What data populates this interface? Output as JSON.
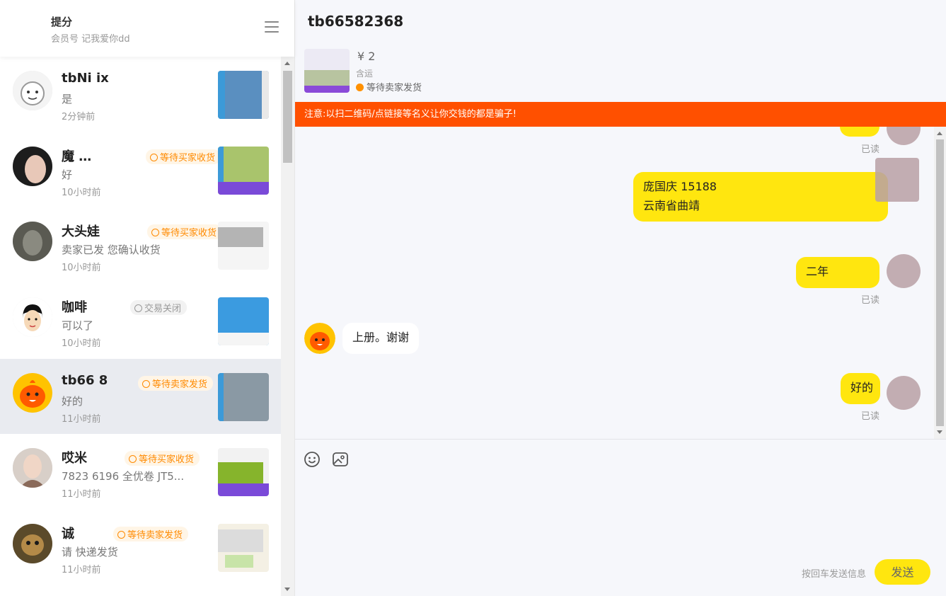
{
  "sidebar": {
    "account_name": "提分",
    "account_sub": "会员号 记我爱你dd",
    "conversations": [
      {
        "name": "tbNi       ix",
        "badge": "",
        "message": "是",
        "time": "2分钟前"
      },
      {
        "name": "魔        …",
        "badge": "等待买家收货",
        "message": "好",
        "time": "10小时前"
      },
      {
        "name": "大头娃",
        "badge": "等待买家收货",
        "message": "卖家已发      您确认收货",
        "time": "10小时前"
      },
      {
        "name": "咖啡",
        "badge": "交易关闭",
        "message": "可以了",
        "time": "10小时前"
      },
      {
        "name": "tb66      8",
        "badge": "等待卖家发货",
        "message": "好的",
        "time": "11小时前"
      },
      {
        "name": "哎米",
        "badge": "等待买家收货",
        "message": "7823     6196 全优卷 JT5...",
        "time": "11小时前"
      },
      {
        "name": "诚",
        "badge": "等待卖家发货",
        "message": "请        快递发货",
        "time": "11小时前"
      }
    ]
  },
  "chat": {
    "title": "tb66582368",
    "order": {
      "price": "¥ 2",
      "shipping": "含运",
      "status": "等待卖家发货"
    },
    "warning": "注意:以扫二维码/点链接等名义让你交钱的都是骗子!",
    "messages": [
      {
        "from": "me",
        "text": "",
        "read": "已读"
      },
      {
        "from": "me",
        "line1": "庞国庆 15188",
        "line2": "云南省曲靖",
        "read": ""
      },
      {
        "from": "me",
        "text": "二年",
        "read": "已读"
      },
      {
        "from": "them",
        "text": "上册。谢谢"
      },
      {
        "from": "me",
        "text": "好的",
        "read": "已读"
      }
    ],
    "composer": {
      "hint": "按回车发送信息",
      "send_label": "发送"
    }
  },
  "colors": {
    "accent_yellow": "#ffe60f",
    "warning_orange": "#ff5000",
    "badge_orange": "#ff8a00"
  }
}
